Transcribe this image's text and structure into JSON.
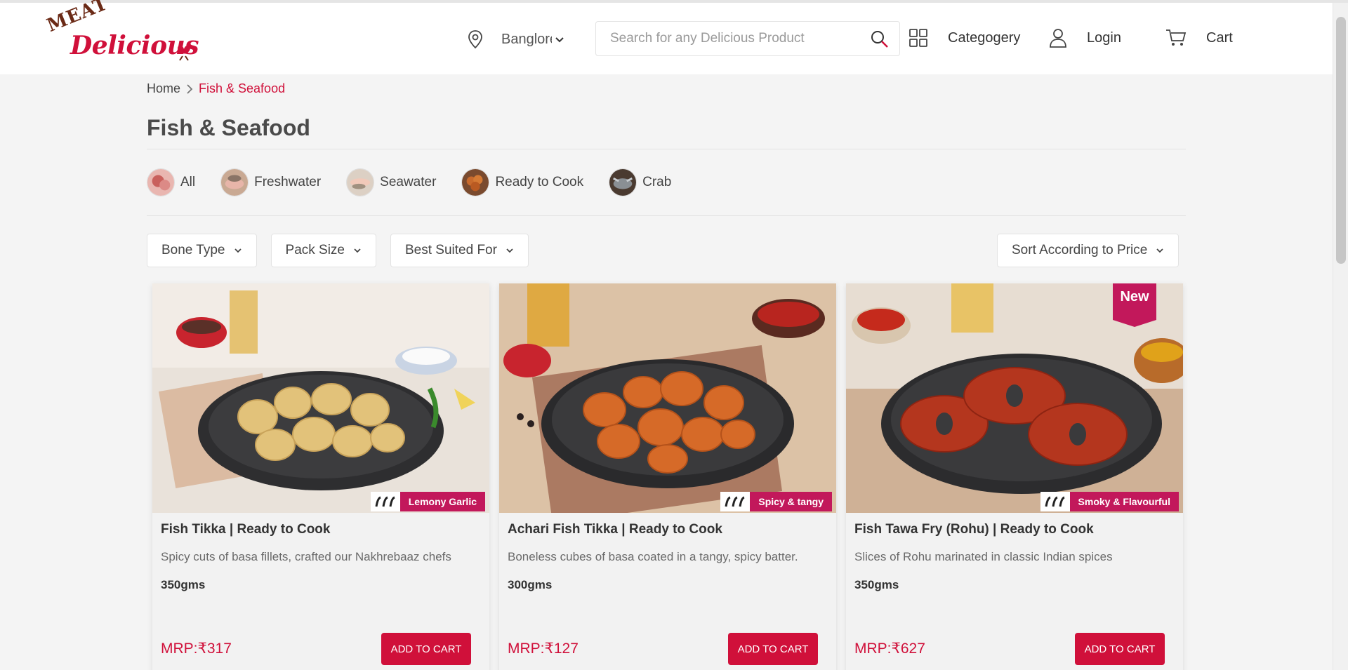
{
  "brand": {
    "logo_top": "MEAT",
    "logo_main": "Delicious"
  },
  "header": {
    "location": "Banglore",
    "search_placeholder": "Search for any Delicious Product",
    "category_label": "Categogery",
    "login_label": "Login",
    "cart_label": "Cart"
  },
  "breadcrumb": {
    "home": "Home",
    "current": "Fish & Seafood"
  },
  "page_title": "Fish & Seafood",
  "categories": [
    "All",
    "Freshwater",
    "Seawater",
    "Ready to Cook",
    "Crab"
  ],
  "filters": {
    "bone_type": "Bone Type",
    "pack_size": "Pack Size",
    "best_suited_for": "Best Suited For",
    "sort": "Sort According to Price"
  },
  "products": [
    {
      "name": "Fish Tikka | Ready to Cook",
      "description": "Spicy cuts of basa fillets, crafted our Nakhrebaaz chefs",
      "weight": "350gms",
      "price": "MRP:₹317",
      "tag": "Lemony Garlic",
      "badge": "",
      "button": "ADD TO CART"
    },
    {
      "name": "Achari Fish Tikka | Ready to Cook",
      "description": "Boneless cubes of basa coated in a tangy, spicy batter.",
      "weight": "300gms",
      "price": "MRP:₹127",
      "tag": "Spicy & tangy",
      "badge": "",
      "button": "ADD TO CART"
    },
    {
      "name": "Fish Tawa Fry (Rohu) | Ready to Cook",
      "description": "Slices of Rohu marinated in classic Indian spices",
      "weight": "350gms",
      "price": "MRP:₹627",
      "tag": "Smoky & Flavourful",
      "badge": "New",
      "button": "ADD TO CART"
    }
  ],
  "colors": {
    "accent": "#d0103a",
    "tag": "#c2185b",
    "background": "#f4f4f4"
  }
}
